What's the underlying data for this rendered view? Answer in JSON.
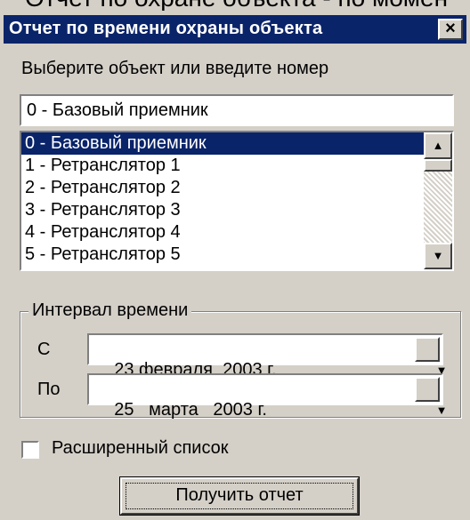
{
  "background_title": "Отчет по охране объекта - по момен",
  "dialog": {
    "title": "Отчет по времени охраны объекта",
    "close_glyph": "×"
  },
  "object_picker": {
    "prompt": "Выберите объект или введите номер",
    "search_value": "0 - Базовый приемник",
    "items": [
      "0 - Базовый приемник",
      "1 - Ретранслятор 1",
      "2 - Ретранслятор 2",
      "3 - Ретранслятор 3",
      "4 - Ретранслятор 4",
      "5 - Ретранслятор 5"
    ],
    "selected_index": 0
  },
  "interval": {
    "legend": "Интервал времени",
    "from_label": "С",
    "from_value": "23 февраля  2003 г.",
    "to_label": "По",
    "to_value": "25   марта   2003 г."
  },
  "extended_list": {
    "label": "Расширенный список",
    "checked": false
  },
  "submit_label": "Получить отчет",
  "icons": {
    "dropdown": "triangle-down",
    "scroll_up": "triangle-up",
    "scroll_down": "triangle-down"
  },
  "colors": {
    "titlebar": "#0a246a",
    "face": "#d4d0c8",
    "selection": "#0a246a"
  }
}
